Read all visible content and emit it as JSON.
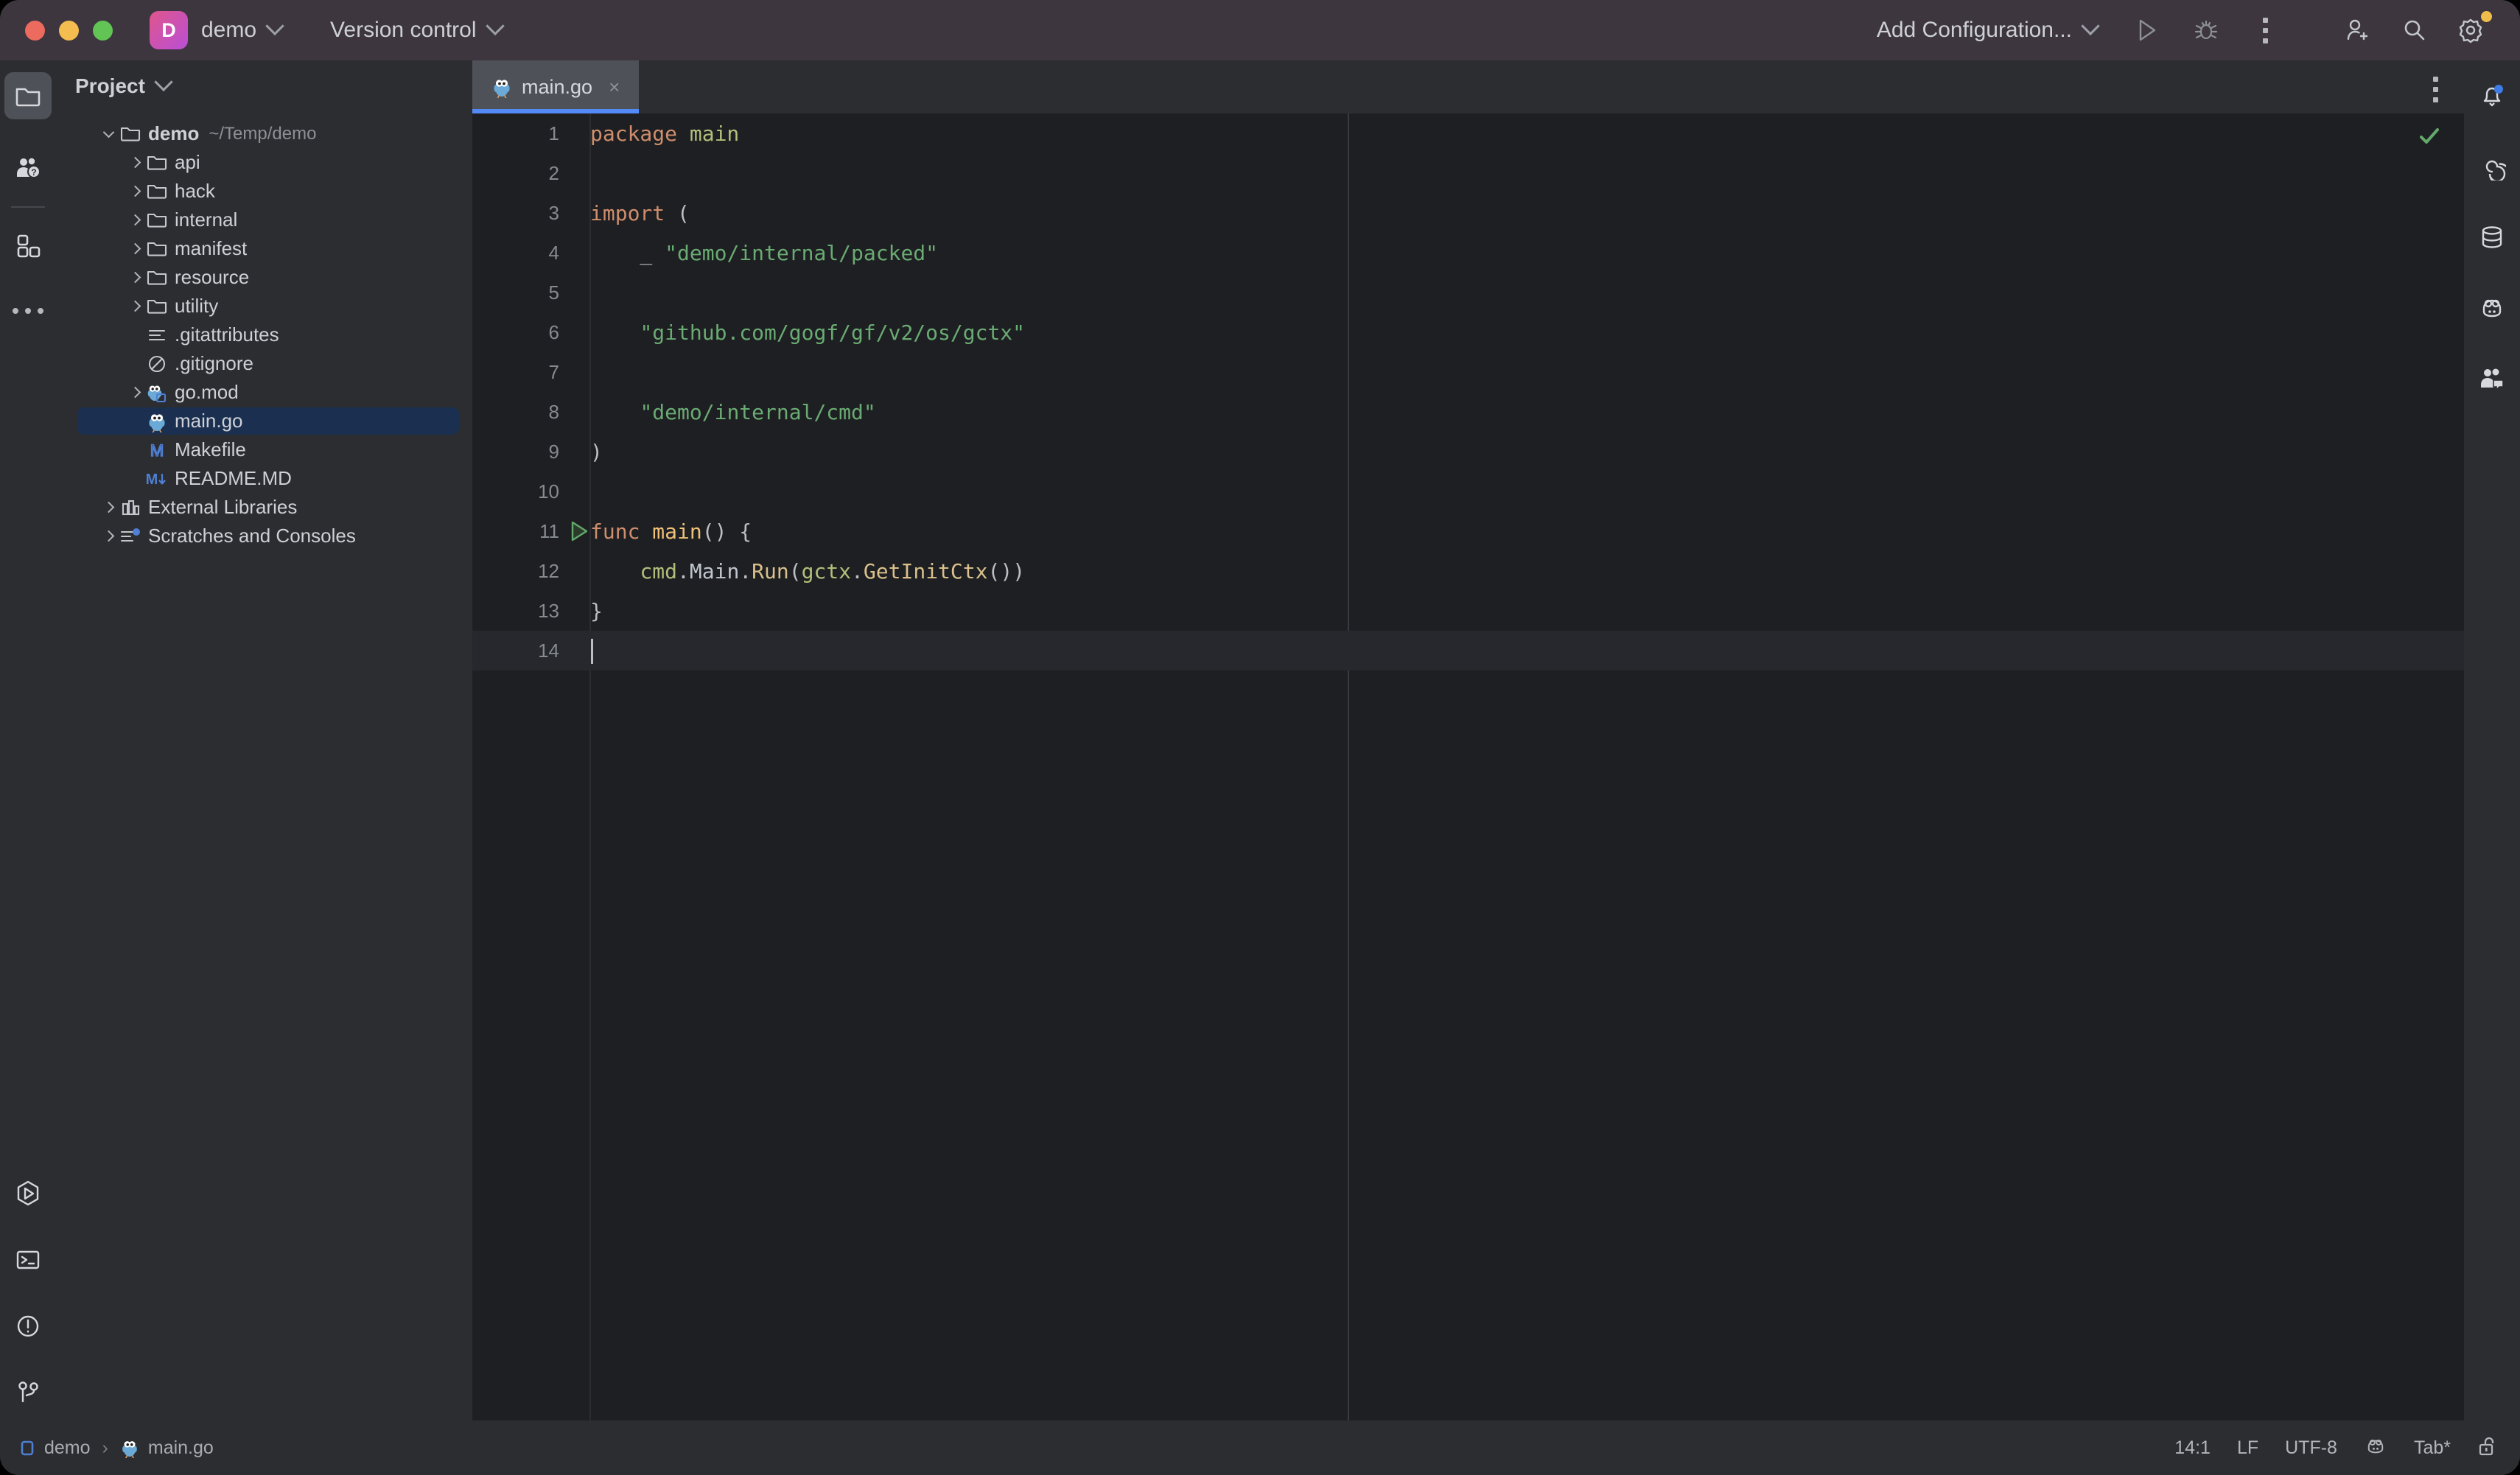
{
  "window": {
    "traffic_lights": [
      "close",
      "minimize",
      "maximize"
    ],
    "project_badge_letter": "D",
    "project_name": "demo",
    "vcs_label": "Version control",
    "run_config_label": "Add Configuration...",
    "icons": [
      "run-icon",
      "debug-icon",
      "more-actions-icon",
      "add-account-icon",
      "search-everywhere-icon",
      "settings-icon"
    ]
  },
  "left_rail": {
    "top": [
      {
        "name": "project-tool-window",
        "icon": "folder-icon",
        "active": true
      },
      {
        "name": "ai-assistant-tool-window",
        "icon": "people-question-icon",
        "active": false
      },
      {
        "name": "plugins-tool-window",
        "icon": "blocks-icon",
        "active": false
      },
      {
        "name": "more-tool-windows",
        "icon": "ellipsis-icon",
        "active": false
      }
    ],
    "bottom": [
      {
        "name": "run-tool-window",
        "icon": "run-hexagon-icon"
      },
      {
        "name": "terminal-tool-window",
        "icon": "terminal-icon"
      },
      {
        "name": "problems-tool-window",
        "icon": "warning-circle-icon"
      },
      {
        "name": "version-control-tool-window",
        "icon": "git-branch-icon"
      }
    ]
  },
  "right_rail": {
    "items": [
      {
        "name": "notifications",
        "icon": "bell-icon",
        "badge": true
      },
      {
        "name": "ai-chat",
        "icon": "spiral-icon",
        "badge": false
      },
      {
        "name": "database",
        "icon": "database-icon",
        "badge": false
      },
      {
        "name": "go-tool",
        "icon": "gopher-icon",
        "badge": false
      },
      {
        "name": "code-with-me",
        "icon": "people-chat-icon",
        "badge": false
      }
    ]
  },
  "project_panel": {
    "title": "Project",
    "tree": [
      {
        "label": "demo",
        "sub": "~/Temp/demo",
        "icon": "folder-icon",
        "indent": 0,
        "arrow": "down",
        "bold": true,
        "selected": false
      },
      {
        "label": "api",
        "sub": "",
        "icon": "folder-icon",
        "indent": 1,
        "arrow": "right",
        "bold": false,
        "selected": false
      },
      {
        "label": "hack",
        "sub": "",
        "icon": "folder-icon",
        "indent": 1,
        "arrow": "right",
        "bold": false,
        "selected": false
      },
      {
        "label": "internal",
        "sub": "",
        "icon": "folder-icon",
        "indent": 1,
        "arrow": "right",
        "bold": false,
        "selected": false
      },
      {
        "label": "manifest",
        "sub": "",
        "icon": "folder-icon",
        "indent": 1,
        "arrow": "right",
        "bold": false,
        "selected": false
      },
      {
        "label": "resource",
        "sub": "",
        "icon": "folder-icon",
        "indent": 1,
        "arrow": "right",
        "bold": false,
        "selected": false
      },
      {
        "label": "utility",
        "sub": "",
        "icon": "folder-icon",
        "indent": 1,
        "arrow": "right",
        "bold": false,
        "selected": false
      },
      {
        "label": ".gitattributes",
        "sub": "",
        "icon": "text-file-icon",
        "indent": 1,
        "arrow": "none",
        "bold": false,
        "selected": false
      },
      {
        "label": ".gitignore",
        "sub": "",
        "icon": "ignore-file-icon",
        "indent": 1,
        "arrow": "none",
        "bold": false,
        "selected": false
      },
      {
        "label": "go.mod",
        "sub": "",
        "icon": "go-mod-icon",
        "indent": 1,
        "arrow": "right",
        "bold": false,
        "selected": false
      },
      {
        "label": "main.go",
        "sub": "",
        "icon": "gopher-icon",
        "indent": 1,
        "arrow": "none",
        "bold": false,
        "selected": true
      },
      {
        "label": "Makefile",
        "sub": "",
        "icon": "makefile-icon",
        "indent": 1,
        "arrow": "none",
        "bold": false,
        "selected": false
      },
      {
        "label": "README.MD",
        "sub": "",
        "icon": "markdown-icon",
        "indent": 1,
        "arrow": "none",
        "bold": false,
        "selected": false
      },
      {
        "label": "External Libraries",
        "sub": "",
        "icon": "libraries-icon",
        "indent": 0,
        "arrow": "right",
        "bold": false,
        "selected": false
      },
      {
        "label": "Scratches and Consoles",
        "sub": "",
        "icon": "scratches-icon",
        "indent": 0,
        "arrow": "right",
        "bold": false,
        "selected": false
      }
    ]
  },
  "editor": {
    "tabs": [
      {
        "label": "main.go",
        "icon": "gopher-icon",
        "active": true,
        "close_glyph": "×"
      }
    ],
    "tab_options_icon": "more-vertical-icon",
    "inspection_status": "ok",
    "gutter_run_line": 11,
    "current_line": 14,
    "lines": [
      {
        "n": "1",
        "tokens": [
          {
            "t": "package ",
            "c": "t-kw"
          },
          {
            "t": "main",
            "c": "t-pkg"
          }
        ]
      },
      {
        "n": "2",
        "tokens": []
      },
      {
        "n": "3",
        "tokens": [
          {
            "t": "import",
            "c": "t-kw"
          },
          {
            "t": " (",
            "c": "t-punc"
          }
        ]
      },
      {
        "n": "4",
        "tokens": [
          {
            "t": "    _ ",
            "c": "t-punc"
          },
          {
            "t": "\"demo/internal/packed\"",
            "c": "t-str"
          }
        ]
      },
      {
        "n": "5",
        "tokens": []
      },
      {
        "n": "6",
        "tokens": [
          {
            "t": "    ",
            "c": "t-punc"
          },
          {
            "t": "\"github.com/gogf/gf/v2/os/gctx\"",
            "c": "t-str"
          }
        ]
      },
      {
        "n": "7",
        "tokens": []
      },
      {
        "n": "8",
        "tokens": [
          {
            "t": "    ",
            "c": "t-punc"
          },
          {
            "t": "\"demo/internal/cmd\"",
            "c": "t-str"
          }
        ]
      },
      {
        "n": "9",
        "tokens": [
          {
            "t": ")",
            "c": "t-punc"
          }
        ]
      },
      {
        "n": "10",
        "tokens": []
      },
      {
        "n": "11",
        "tokens": [
          {
            "t": "func ",
            "c": "t-kw"
          },
          {
            "t": "main",
            "c": "t-fn"
          },
          {
            "t": "() {",
            "c": "t-punc"
          }
        ]
      },
      {
        "n": "12",
        "tokens": [
          {
            "t": "    ",
            "c": "t-punc"
          },
          {
            "t": "cmd",
            "c": "t-id"
          },
          {
            "t": ".",
            "c": "t-dot"
          },
          {
            "t": "Main",
            "c": "t-prop"
          },
          {
            "t": ".",
            "c": "t-dot"
          },
          {
            "t": "Run",
            "c": "t-call"
          },
          {
            "t": "(",
            "c": "t-punc"
          },
          {
            "t": "gctx",
            "c": "t-id"
          },
          {
            "t": ".",
            "c": "t-dot"
          },
          {
            "t": "GetInitCtx",
            "c": "t-call"
          },
          {
            "t": "())",
            "c": "t-punc"
          }
        ]
      },
      {
        "n": "13",
        "tokens": [
          {
            "t": "}",
            "c": "t-punc"
          }
        ]
      },
      {
        "n": "14",
        "tokens": []
      }
    ]
  },
  "status_bar": {
    "breadcrumbs": [
      {
        "label": "demo",
        "icon": "module-icon"
      },
      {
        "label": "main.go",
        "icon": "gopher-icon"
      }
    ],
    "separator": "›",
    "right": [
      {
        "name": "caret-position",
        "label": "14:1"
      },
      {
        "name": "line-separator",
        "label": "LF"
      },
      {
        "name": "file-encoding",
        "label": "UTF-8"
      },
      {
        "name": "go-sdk",
        "label": "",
        "icon": "gopher-icon"
      },
      {
        "name": "indent-setting",
        "label": "Tab*"
      },
      {
        "name": "read-only-toggle",
        "label": "",
        "icon": "lock-open-icon"
      }
    ]
  },
  "colors": {
    "titlebar": "#3d363f",
    "panel": "#2b2d30",
    "editor": "#1e1f22",
    "accent_blue": "#548af7",
    "selection": "#1b3050",
    "keyword": "#cf8e6d",
    "string": "#6aab73",
    "function": "#f0c178",
    "ok_green": "#62a96b"
  }
}
